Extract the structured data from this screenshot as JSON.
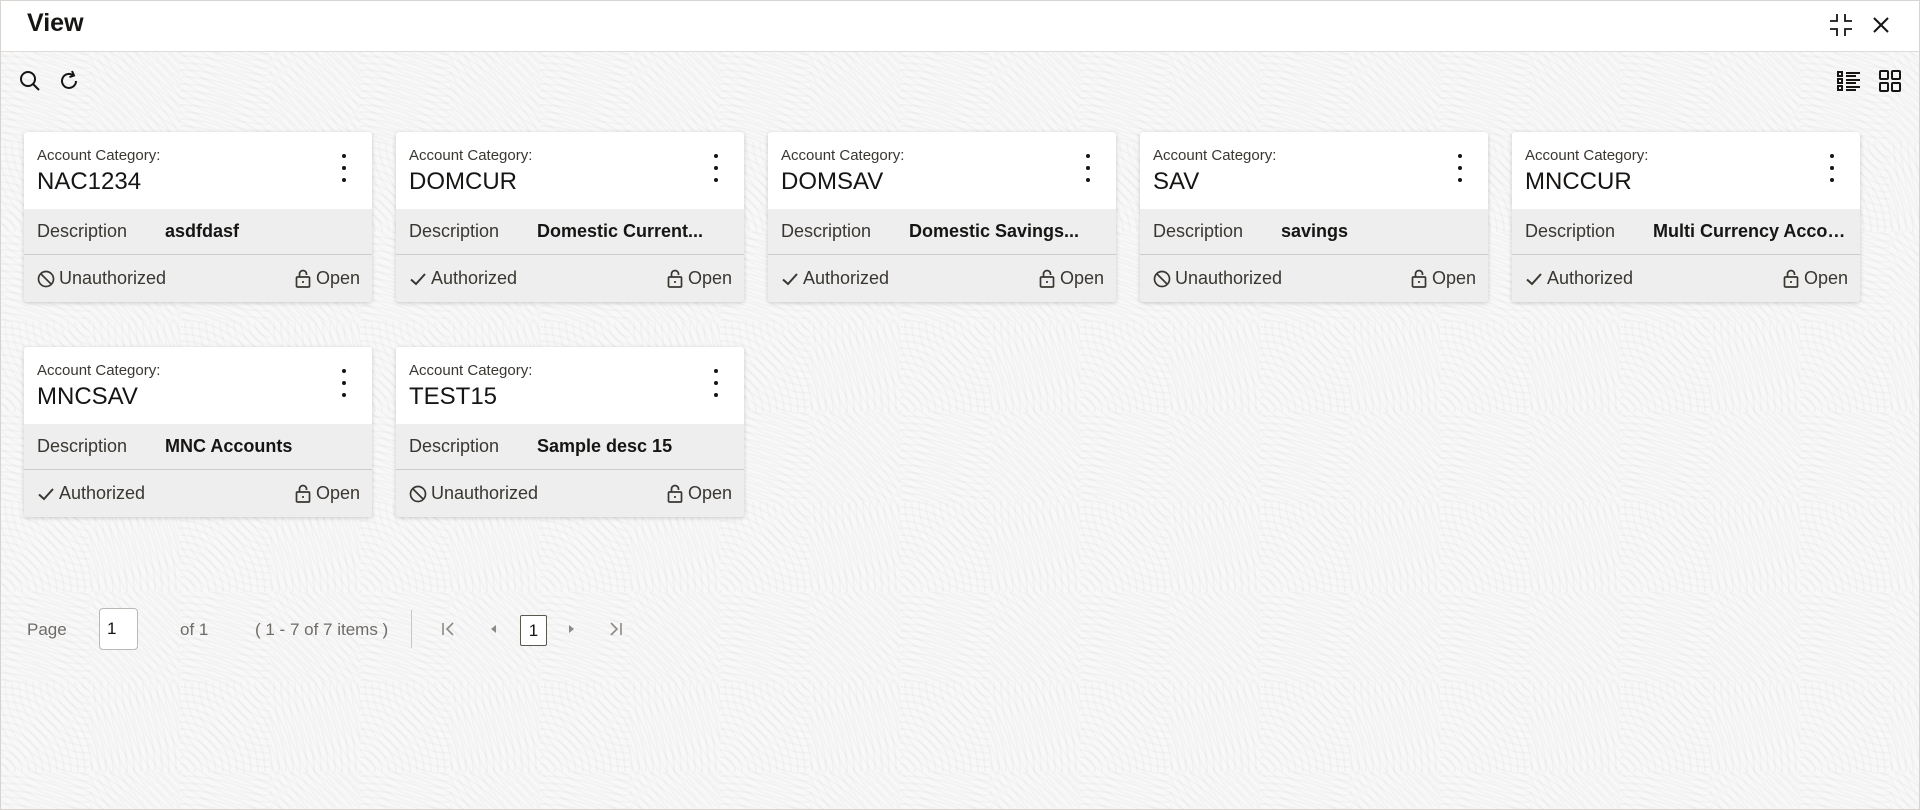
{
  "window": {
    "title": "View",
    "icons": {
      "minimize": "compress-icon",
      "close": "close-icon"
    }
  },
  "toolbar": {
    "left_icons": [
      "search-icon",
      "refresh-icon"
    ],
    "right_icons": [
      "list-view-icon",
      "grid-view-icon"
    ]
  },
  "cards": [
    {
      "label": "Account Category:",
      "code": "NAC1234",
      "desc_label": "Description",
      "desc_value": "asdfdasf",
      "status": "Unauthorized",
      "status_icon": "unauthorized-icon",
      "lock": "Open",
      "lock_icon": "unlock-icon"
    },
    {
      "label": "Account Category:",
      "code": "DOMCUR",
      "desc_label": "Description",
      "desc_value": "Domestic Current...",
      "status": "Authorized",
      "status_icon": "check-icon",
      "lock": "Open",
      "lock_icon": "unlock-icon"
    },
    {
      "label": "Account Category:",
      "code": "DOMSAV",
      "desc_label": "Description",
      "desc_value": "Domestic Savings...",
      "status": "Authorized",
      "status_icon": "check-icon",
      "lock": "Open",
      "lock_icon": "unlock-icon"
    },
    {
      "label": "Account Category:",
      "code": "SAV",
      "desc_label": "Description",
      "desc_value": "savings",
      "status": "Unauthorized",
      "status_icon": "unauthorized-icon",
      "lock": "Open",
      "lock_icon": "unlock-icon"
    },
    {
      "label": "Account Category:",
      "code": "MNCCUR",
      "desc_label": "Description",
      "desc_value": "Multi Currency Accou...",
      "status": "Authorized",
      "status_icon": "check-icon",
      "lock": "Open",
      "lock_icon": "unlock-icon"
    },
    {
      "label": "Account Category:",
      "code": "MNCSAV",
      "desc_label": "Description",
      "desc_value": "MNC Accounts",
      "status": "Authorized",
      "status_icon": "check-icon",
      "lock": "Open",
      "lock_icon": "unlock-icon"
    },
    {
      "label": "Account Category:",
      "code": "TEST15",
      "desc_label": "Description",
      "desc_value": "Sample desc 15",
      "status": "Unauthorized",
      "status_icon": "unauthorized-icon",
      "lock": "Open",
      "lock_icon": "unlock-icon"
    }
  ],
  "pagination": {
    "page_label": "Page",
    "page_value": "1",
    "of_text": "of 1",
    "range_text": "( 1 - 7 of 7 items )",
    "current_page": "1",
    "nav_icons": [
      "first-page-icon",
      "previous-page-icon",
      "next-page-icon",
      "last-page-icon"
    ]
  }
}
